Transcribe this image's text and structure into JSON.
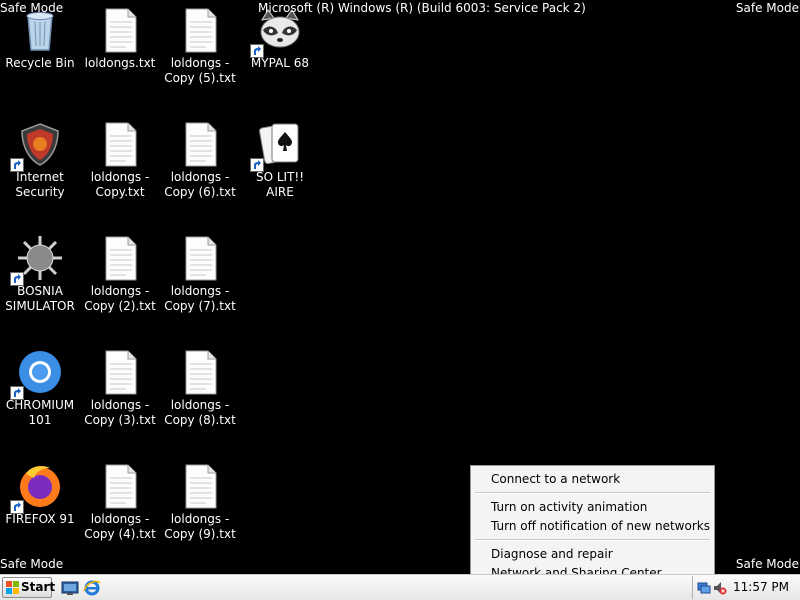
{
  "overlay": {
    "safe_mode_label": "Safe Mode",
    "banner": "Microsoft (R) Windows (R) (Build 6003: Service Pack 2)"
  },
  "desktop": {
    "icons": [
      {
        "label": "Recycle Bin",
        "icon": "recycle-bin-icon"
      },
      {
        "label": "loldongs.txt",
        "icon": "text-file-icon"
      },
      {
        "label": "loldongs - Copy (5).txt",
        "icon": "text-file-icon"
      },
      {
        "label": "MYPAL 68",
        "icon": "raccoon-browser-icon"
      },
      {
        "label": "Internet Security",
        "icon": "shield-icon"
      },
      {
        "label": "loldongs - Copy.txt",
        "icon": "text-file-icon"
      },
      {
        "label": "loldongs - Copy (6).txt",
        "icon": "text-file-icon"
      },
      {
        "label": "SO LIT!! AIRE",
        "icon": "solitaire-cards-icon"
      },
      {
        "label": "BOSNIA SIMULATOR",
        "icon": "spiked-ball-icon"
      },
      {
        "label": "loldongs - Copy (2).txt",
        "icon": "text-file-icon"
      },
      {
        "label": "loldongs - Copy (7).txt",
        "icon": "text-file-icon"
      },
      {
        "label": "CHROMIUM 101",
        "icon": "chromium-icon"
      },
      {
        "label": "loldongs - Copy (3).txt",
        "icon": "text-file-icon"
      },
      {
        "label": "loldongs - Copy (8).txt",
        "icon": "text-file-icon"
      },
      {
        "label": "FIREFOX 91",
        "icon": "firefox-icon"
      },
      {
        "label": "loldongs - Copy (4).txt",
        "icon": "text-file-icon"
      },
      {
        "label": "loldongs - Copy (9).txt",
        "icon": "text-file-icon"
      }
    ]
  },
  "context_menu": {
    "items": [
      "Connect to a network",
      "Turn on activity animation",
      "Turn off notification of new networks",
      "Diagnose and repair",
      "Network and Sharing Center"
    ]
  },
  "taskbar": {
    "start_label": "Start",
    "quick_launch": [
      "show-desktop-icon",
      "internet-explorer-icon"
    ],
    "tray_icons": [
      "network-icon",
      "volume-muted-icon"
    ],
    "clock": "11:57 PM"
  }
}
